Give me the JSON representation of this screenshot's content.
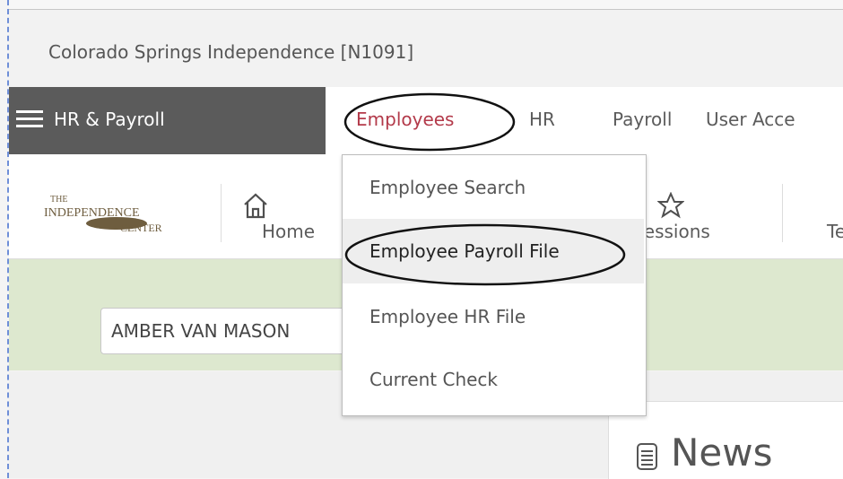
{
  "org": {
    "title": "Colorado Springs Independence [N1091]"
  },
  "app": {
    "menu_title": "HR & Payroll"
  },
  "nav": {
    "items": [
      {
        "label": "Employees"
      },
      {
        "label": "HR"
      },
      {
        "label": "Payroll"
      },
      {
        "label": "User Acce"
      }
    ]
  },
  "toolbar": {
    "logo_text": "THE INDEPENDENCE CENTER",
    "home_label": "Home",
    "impressions_label": "ressions",
    "te_label": "Te"
  },
  "filter": {
    "employee_value": "AMBER VAN MASON"
  },
  "dropdown": {
    "items": [
      {
        "label": "Employee Search"
      },
      {
        "label": "Employee Payroll File"
      },
      {
        "label": "Employee HR File"
      },
      {
        "label": "Current Check"
      }
    ]
  },
  "news": {
    "title": "News"
  },
  "colors": {
    "accent": "#b33a4a",
    "menu_bg": "#5b5b5b",
    "filter_bg": "#dde8cf"
  }
}
